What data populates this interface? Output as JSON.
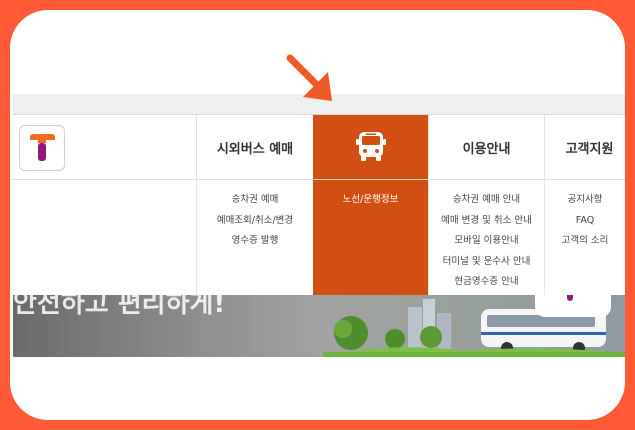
{
  "colors": {
    "frame": "#ff5a36",
    "active_menu": "#d24f14",
    "logo_orange": "#f26a1b",
    "logo_purple": "#8e1c7a",
    "arrow": "#f05a28"
  },
  "logo": {
    "icon": "t-logo-icon"
  },
  "nav": {
    "items": [
      {
        "label": "시외버스 예매",
        "active": false
      },
      {
        "label": "",
        "icon": "bus-icon",
        "active": true
      },
      {
        "label": "이용안내",
        "active": false
      },
      {
        "label": "고객지원",
        "active": false
      }
    ]
  },
  "dropdown": {
    "columns": [
      {
        "links": [
          "승차권 예매",
          "예매조회/취소/변경",
          "영수증 발행"
        ]
      },
      {
        "links": [
          "노선/운행정보"
        ]
      },
      {
        "links": [
          "승차권 예매 안내",
          "예매 변경 및 취소 안내",
          "모바일 이용안내",
          "터미널 및 운수사 안내",
          "현금영수증 안내"
        ]
      },
      {
        "links": [
          "공지사항",
          "FAQ",
          "고객의 소리"
        ]
      }
    ]
  },
  "banner": {
    "text": "안전하고 편리하게!"
  },
  "annotation": {
    "icon": "arrow-pointer-icon"
  }
}
